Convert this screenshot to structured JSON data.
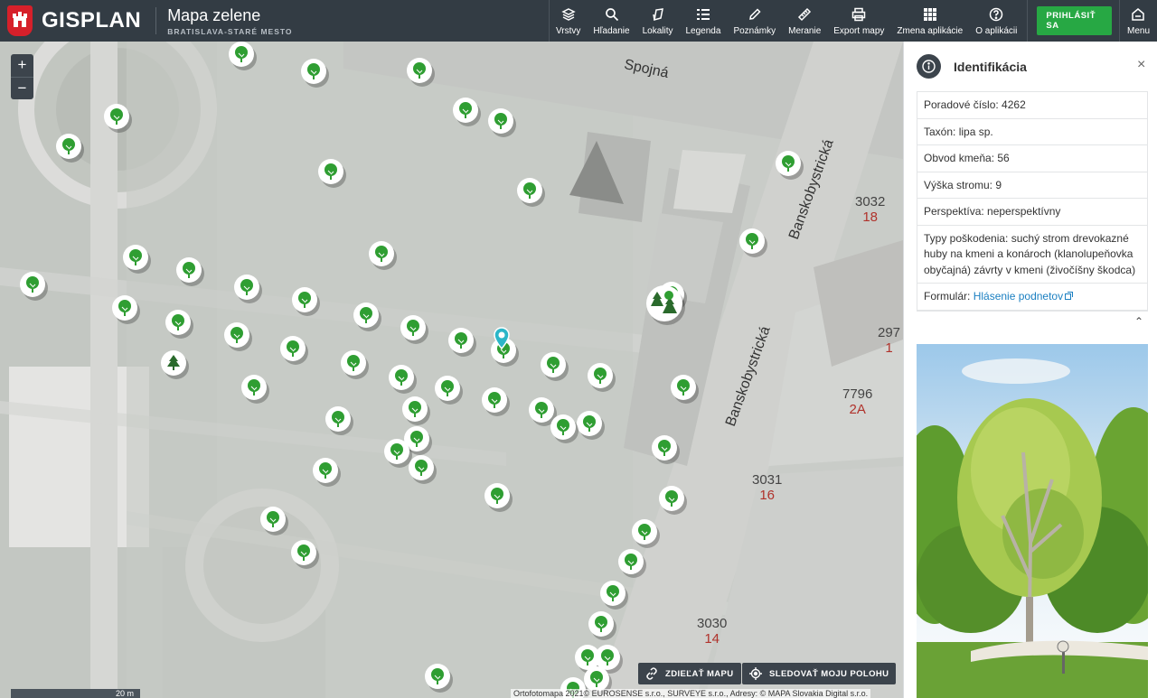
{
  "header": {
    "logo_text": "GISPLAN",
    "app_title": "Mapa zelene",
    "app_subtitle": "BRATISLAVA-STARÉ MESTO",
    "tools": [
      {
        "label": "Vrstvy",
        "icon": "layers-icon"
      },
      {
        "label": "Hľadanie",
        "icon": "search-icon"
      },
      {
        "label": "Lokality",
        "icon": "bookmark-icon"
      },
      {
        "label": "Legenda",
        "icon": "list-icon"
      },
      {
        "label": "Poznámky",
        "icon": "pencil-icon"
      },
      {
        "label": "Meranie",
        "icon": "ruler-icon"
      },
      {
        "label": "Export mapy",
        "icon": "printer-icon"
      },
      {
        "label": "Zmena aplikácie",
        "icon": "apps-grid-icon"
      },
      {
        "label": "O aplikácii",
        "icon": "help-icon"
      }
    ],
    "login_label": "PRIHLÁSIŤ SA",
    "menu_label": "Menu"
  },
  "map": {
    "zoom_in": "+",
    "zoom_out": "−",
    "street_labels": [
      "Spojná",
      "Banskobystrická",
      "Banskobystrická"
    ],
    "house_numbers": [
      {
        "num": "3032",
        "sub": "18"
      },
      {
        "num": "297",
        "sub": "1"
      },
      {
        "num": "7796",
        "sub": "2A"
      },
      {
        "num": "3031",
        "sub": "16"
      },
      {
        "num": "3030",
        "sub": "14"
      }
    ],
    "share_label": "ZDIEĽAŤ MAPU",
    "track_label": "SLEDOVAŤ MOJU POLOHU",
    "scale_label": "20 m",
    "attribution": "Ortofotomapa 2021© EUROSENSE s.r.o., SURVEYE s.r.o., Adresy: © MAPA Slovakia Digital s.r.o.",
    "colors": {
      "tree_green": "#2f9e32",
      "marker": "#2bb6c8"
    }
  },
  "panel": {
    "title": "Identifikácia",
    "close": "×",
    "rows": {
      "poradove": "Poradové číslo: 4262",
      "taxon": "Taxón: lipa sp.",
      "obvod": "Obvod kmeňa: 56",
      "vyska": "Výška stromu: 9",
      "perspektiva": "Perspektíva: neperspektívny",
      "typy": "Typy poškodenia: suchý strom drevokazné huby na kmeni a konároch (klanolupeňovka obyčajná) závrty v kmeni (živočíšny škodca)",
      "formular_label": "Formulár:",
      "formular_link": "Hlásenie podnetov"
    },
    "collapse": "⌃"
  }
}
